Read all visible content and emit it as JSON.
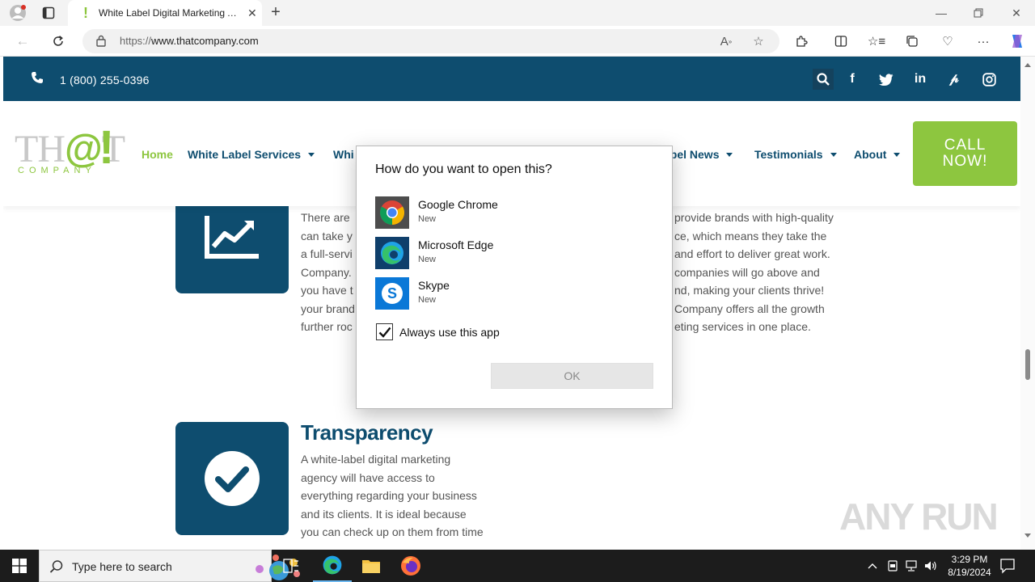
{
  "browser": {
    "tab_title": "White Label Digital Marketing Agency",
    "url_scheme": "https://",
    "url_host": "www.thatcompany.com"
  },
  "site": {
    "phone": "1 (800) 255-0396",
    "logo": {
      "main": "TH",
      "at": "@",
      "t": "T",
      "bang": "!",
      "sub": "COMPANY"
    },
    "nav": [
      {
        "label": "Home"
      },
      {
        "label": "White Label Services"
      },
      {
        "label": "Whi"
      },
      {
        "label": "abel News"
      },
      {
        "label": "Testimonials"
      },
      {
        "label": "About"
      }
    ],
    "cta": "CALL NOW!",
    "feature1": {
      "left_lines": [
        "There are",
        "can take y",
        "a full-servi",
        "Company.",
        "you have t",
        "your brand",
        "further roc"
      ],
      "right_lines": [
        "provide brands with high-quality",
        "ce, which means they take the",
        "and effort to deliver great work.",
        "companies will go above and",
        "nd, making your clients thrive!",
        "Company offers all the growth",
        "eting services in one place."
      ]
    },
    "feature2": {
      "title": "Transparency",
      "lines": [
        "A white-label digital marketing",
        "agency will have access to",
        "everything regarding your business",
        "and its clients. It is ideal because",
        "you can check up on them from time"
      ]
    }
  },
  "dialog": {
    "title": "How do you want to open this?",
    "apps": [
      {
        "name": "Google Chrome",
        "badge": "New"
      },
      {
        "name": "Microsoft Edge",
        "badge": "New"
      },
      {
        "name": "Skype",
        "badge": "New"
      }
    ],
    "always_label": "Always use this app",
    "always_checked": true,
    "ok_label": "OK"
  },
  "watermark": "ANY RUN",
  "taskbar": {
    "search_placeholder": "Type here to search",
    "time": "3:29 PM",
    "date": "8/19/2024"
  },
  "colors": {
    "brand_blue": "#0e4d6f",
    "brand_green": "#8dc63f"
  }
}
